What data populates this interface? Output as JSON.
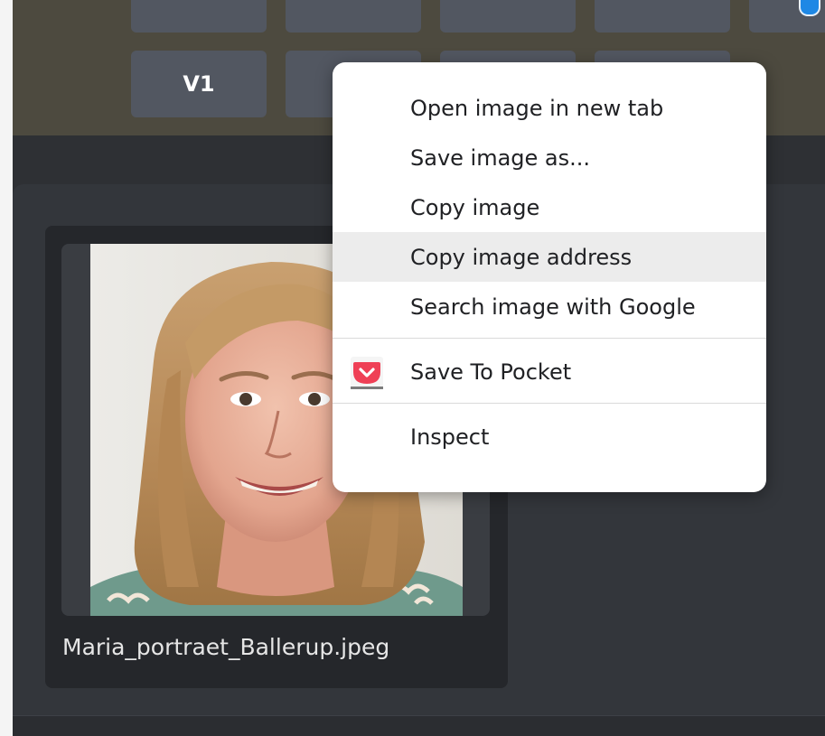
{
  "keyboard": {
    "row1": [
      "",
      "",
      "",
      "",
      ""
    ],
    "row2": [
      "V1",
      "",
      "",
      ""
    ]
  },
  "file": {
    "name": "Maria_portraet_Ballerup.jpeg"
  },
  "context_menu": {
    "items": [
      {
        "label": "Open image in new tab"
      },
      {
        "label": "Save image as..."
      },
      {
        "label": "Copy image"
      },
      {
        "label": "Copy image address",
        "highlighted": true
      },
      {
        "label": "Search image with Google"
      }
    ],
    "extension_item": {
      "label": "Save To Pocket",
      "icon": "pocket-icon"
    },
    "devtools_item": {
      "label": "Inspect"
    }
  },
  "colors": {
    "top_band": "#4d4a3f",
    "key": "#525761",
    "main_bg": "#2e3034",
    "menu_highlight": "#ececec",
    "pocket": "#ef4056"
  }
}
